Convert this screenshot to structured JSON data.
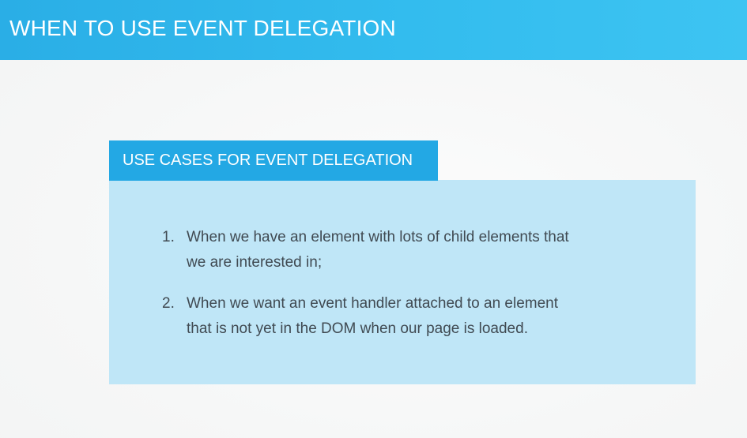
{
  "slide": {
    "title": "WHEN TO USE EVENT DELEGATION",
    "card": {
      "header": "USE CASES FOR EVENT DELEGATION",
      "items": [
        {
          "number": "1.",
          "line1": "When we have an element with lots of child elements that",
          "line2": "we are interested in;"
        },
        {
          "number": "2.",
          "line1": "When we want an event handler attached to an element",
          "line2": "that is not yet in the DOM when our page is loaded."
        }
      ]
    }
  },
  "colors": {
    "title_bar": "#2aaee6",
    "card_header": "#23a8e4",
    "card_body": "#bfe6f7",
    "body_text": "#404a52"
  }
}
